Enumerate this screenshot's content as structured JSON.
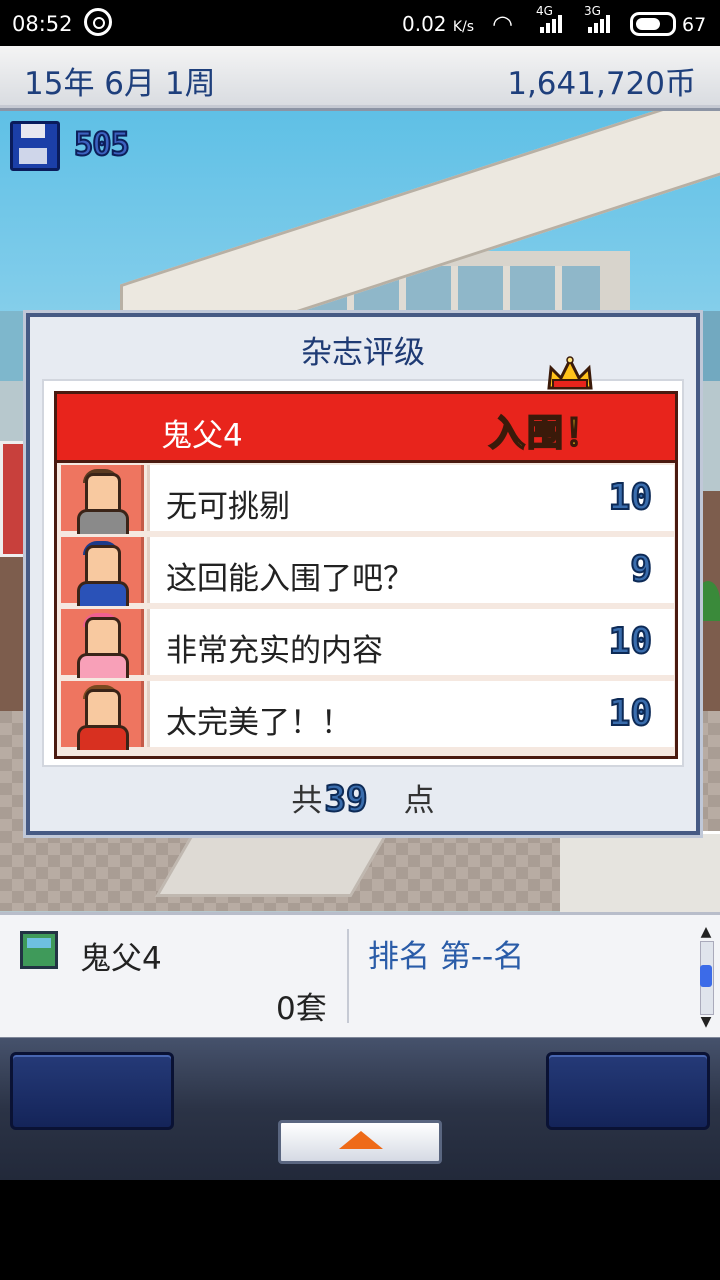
{
  "status_bar": {
    "time": "08:52",
    "net_speed": "0.02",
    "net_speed_unit": "K/s",
    "net1": "4G",
    "net2": "3G",
    "battery": "67"
  },
  "top_bar": {
    "date": "15年 6月 1周",
    "money": "1,641,720币"
  },
  "hud": {
    "research_points": "505"
  },
  "dialog": {
    "title": "杂志评级",
    "game_title": "鬼父4",
    "badge": "入围！",
    "reviews": [
      {
        "comment": "无可挑剔",
        "score": "10",
        "reviewer": "suit-man-avatar"
      },
      {
        "comment": "这回能入围了吧？",
        "score": "9",
        "reviewer": "cap-man-avatar"
      },
      {
        "comment": "非常充实的内容",
        "score": "10",
        "reviewer": "pink-hair-woman-avatar"
      },
      {
        "comment": "太完美了！！",
        "score": "10",
        "reviewer": "brown-hair-man-avatar"
      }
    ],
    "total_prefix": "共",
    "total": "39",
    "total_suffix": "点"
  },
  "info_bar": {
    "game_name": "鬼父4",
    "sales": "0套",
    "rank": "排名 第--名"
  },
  "colors": {
    "header_red": "#e8241c",
    "score_blue": "#3a6dad",
    "title_navy": "#1f3b74"
  }
}
